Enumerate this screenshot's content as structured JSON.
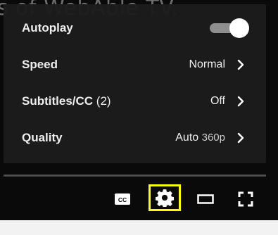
{
  "background_caption": "s of WebAble TV.",
  "settings_menu": {
    "autoplay": {
      "label": "Autoplay",
      "enabled": true
    },
    "speed": {
      "label": "Speed",
      "value": "Normal"
    },
    "subtitles": {
      "label": "Subtitles/CC",
      "count": "(2)",
      "value": "Off"
    },
    "quality": {
      "label": "Quality",
      "value": "Auto",
      "resolution": "360p"
    }
  },
  "controls": {
    "cc_glyph": "CC",
    "icons": [
      "cc-icon",
      "settings-gear-icon",
      "theater-mode-icon",
      "fullscreen-icon"
    ],
    "highlight_color": "#ffff00"
  },
  "colors": {
    "menu_bg": "#1c1c1c",
    "text": "#eeeeee",
    "toggle_track": "#8e8e8e",
    "toggle_knob": "#ffffff"
  }
}
